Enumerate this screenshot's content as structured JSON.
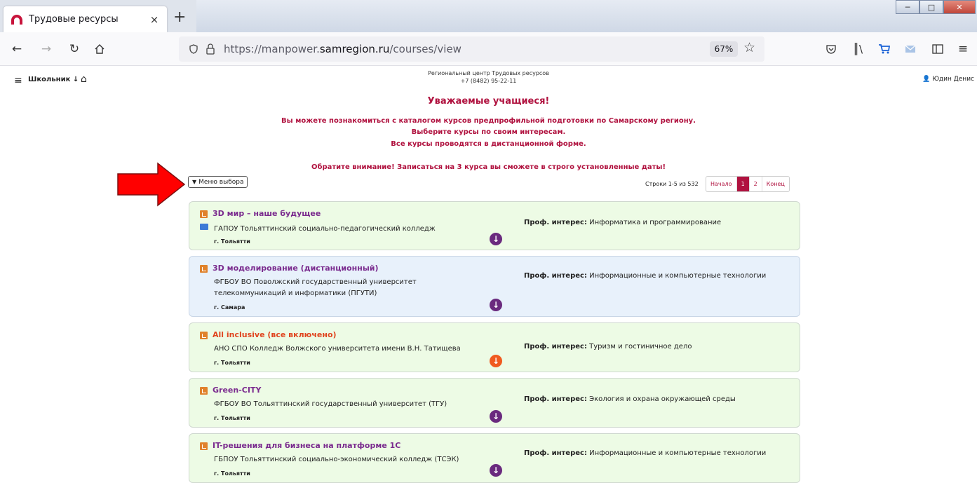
{
  "browser": {
    "tab_title": "Трудовые ресурсы",
    "tab_close": "×",
    "new_tab": "+",
    "url_prefix": "https://manpower.",
    "url_domain": "samregion.ru",
    "url_path": "/courses/view",
    "zoom": "67%"
  },
  "header": {
    "role": "Школьник",
    "org_title": "Региональный центр Трудовых ресурсов",
    "phone": "+7 (8482) 95-22-11",
    "user": "Юдин Денис"
  },
  "notice": {
    "title": "Уважаемые учащиеся!",
    "line1": "Вы можете познакомиться с каталогом курсов предпрофильной подготовки по Самарскому региону.",
    "line2": "Выберите курсы по своим интересам.",
    "line3": "Все курсы проводятся в дистанционной форме.",
    "warning": "Обратите внимание! Записаться на 3 курса вы сможете в строго установленные даты!"
  },
  "controls": {
    "filter_label": "Меню выбора",
    "rows_info": "Строки 1-5 из 532",
    "pager": [
      "Начало",
      "1",
      "2",
      "Конец"
    ]
  },
  "interest_label": "Проф. интерес:",
  "courses": [
    {
      "title": "3D мир – наше будущее",
      "org": "ГАПОУ Тольяттинский социально-педагогический колледж",
      "city": "г. Тольятти",
      "interest": "Информатика и программирование",
      "style": "green"
    },
    {
      "title": "3D моделирование (дистанционный)",
      "org": "ФГБОУ ВО Поволжский государственный университет телекоммуникаций и информатики (ПГУТИ)",
      "city": "г. Самара",
      "interest": "Информационные и компьютерные технологии",
      "style": "blue"
    },
    {
      "title": "All inclusive (все включено)",
      "org": "АНО СПО Колледж Волжского университета имени В.Н. Татищева",
      "city": "г. Тольятти",
      "interest": "Туризм и гостиничное дело",
      "style": "green-orange"
    },
    {
      "title": "Green-CITY",
      "org": "ФГБОУ ВО Тольяттинский государственный университет (ТГУ)",
      "city": "г. Тольятти",
      "interest": "Экология и охрана окружающей среды",
      "style": "green"
    },
    {
      "title": "IT-решения для бизнеса на платформе 1С",
      "org": "ГБПОУ Тольяттинский социально-экономический колледж (ТСЭК)",
      "city": "г. Тольятти",
      "interest": "Информационные и компьютерные технологии",
      "style": "green"
    }
  ],
  "colors": {
    "accent": "#b0123f",
    "card_green": "#edfbe5",
    "card_blue": "#e8f1fb",
    "title_purple": "#7a2b8e",
    "title_orange": "#e0451f",
    "arrow_red": "#ff0000"
  }
}
